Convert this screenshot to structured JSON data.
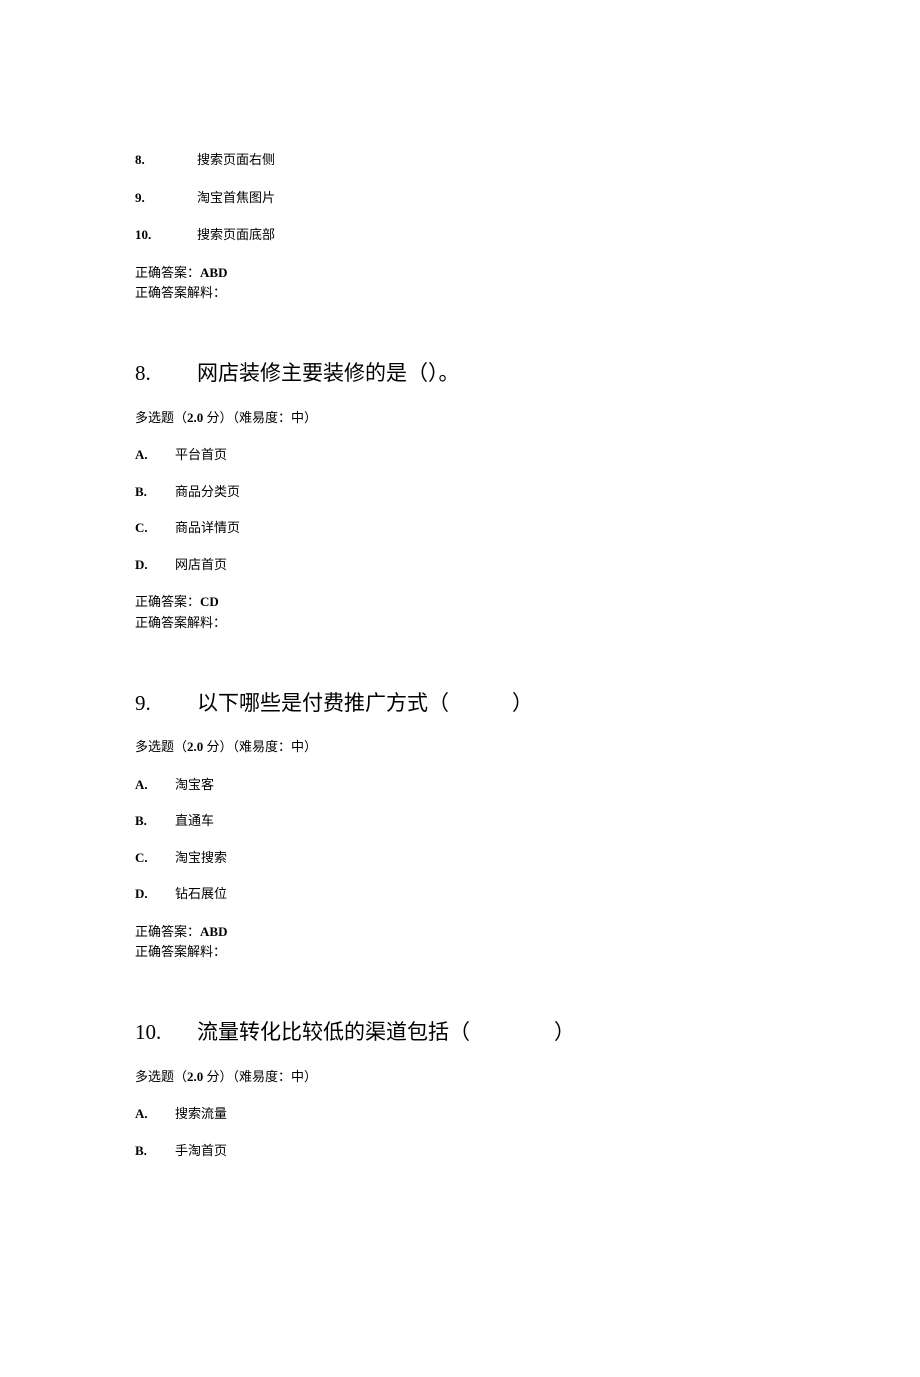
{
  "top_options": [
    {
      "label": "8.",
      "text": "搜索页面右侧"
    },
    {
      "label": "9.",
      "text": "淘宝首焦图片"
    },
    {
      "label": "10.",
      "text": "搜索页面底部"
    }
  ],
  "top_answer": {
    "prefix": "正确答案：",
    "value": "ABD",
    "explain": "正确答案解料："
  },
  "questions": [
    {
      "number": "8.",
      "title": "网店装修主要装修的是（）。",
      "meta_prefix": "多选题（",
      "meta_score": "2.0",
      "meta_mid": " 分）（难易度：中）",
      "choices": [
        {
          "label": "A.",
          "text": "平台首页"
        },
        {
          "label": "B.",
          "text": "商品分类页"
        },
        {
          "label": "C.",
          "text": "商品详情页"
        },
        {
          "label": "D.",
          "text": "网店首页"
        }
      ],
      "answer_prefix": "正确答案：",
      "answer_value": "CD",
      "explain": "正确答案解料："
    },
    {
      "number": "9.",
      "title": "以下哪些是付费推广方式（　　　）",
      "meta_prefix": "多选题（",
      "meta_score": "2.0",
      "meta_mid": " 分）（难易度：中）",
      "choices": [
        {
          "label": "A.",
          "text": "淘宝客"
        },
        {
          "label": "B.",
          "text": "直通车"
        },
        {
          "label": "C.",
          "text": "淘宝搜索"
        },
        {
          "label": "D.",
          "text": "钻石展位"
        }
      ],
      "answer_prefix": "正确答案：",
      "answer_value": "ABD",
      "explain": "正确答案解料："
    },
    {
      "number": "10.",
      "title": "流量转化比较低的渠道包括（　　　　）",
      "meta_prefix": "多选题（",
      "meta_score": "2.0",
      "meta_mid": " 分）（难易度：中）",
      "choices": [
        {
          "label": "A.",
          "text": "搜索流量"
        },
        {
          "label": "B.",
          "text": "手淘首页"
        }
      ],
      "answer_prefix": "",
      "answer_value": "",
      "explain": ""
    }
  ]
}
